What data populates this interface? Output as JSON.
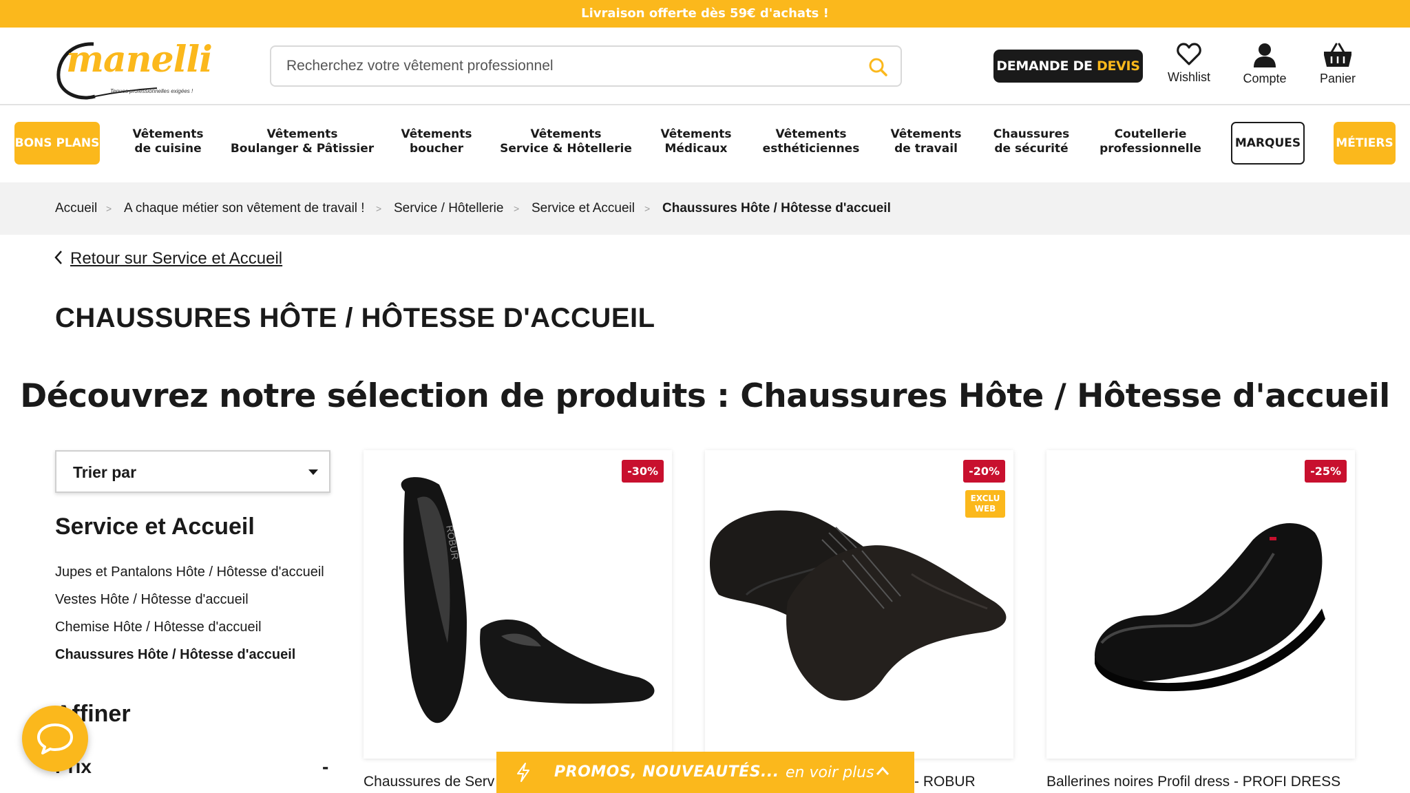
{
  "topbar": {
    "text": "Livraison offerte dès 59€ d'achats !"
  },
  "logo": {
    "word_first": "m",
    "word_rest": "anelli",
    "tagline": "Tenues professionnelles exigées !"
  },
  "search": {
    "placeholder": "Recherchez votre vêtement professionnel"
  },
  "devis": {
    "label_main": "DEMANDE DE ",
    "label_highlight": "DEVIS"
  },
  "header_icons": {
    "wishlist": "Wishlist",
    "account": "Compte",
    "cart": "Panier"
  },
  "nav": {
    "bons_plans": "BONS PLANS",
    "items": [
      {
        "l1": "Vêtements",
        "l2": "de cuisine"
      },
      {
        "l1": "Vêtements",
        "l2": "Boulanger & Pâtissier"
      },
      {
        "l1": "Vêtements",
        "l2": "boucher"
      },
      {
        "l1": "Vêtements",
        "l2": "Service & Hôtellerie"
      },
      {
        "l1": "Vêtements",
        "l2": "Médicaux"
      },
      {
        "l1": "Vêtements",
        "l2": "esthéticiennes"
      },
      {
        "l1": "Vêtements",
        "l2": "de travail"
      },
      {
        "l1": "Chaussures",
        "l2": "de sécurité"
      },
      {
        "l1": "Coutellerie",
        "l2": "professionnelle"
      }
    ],
    "marques": "MARQUES",
    "metiers": "MÉTIERS"
  },
  "breadcrumb": {
    "items": [
      "Accueil",
      "A chaque métier son vêtement de travail !",
      "Service / Hôtellerie",
      "Service et Accueil"
    ],
    "current": "Chaussures Hôte / Hôtesse d'accueil",
    "separator": ">"
  },
  "back_link": "Retour sur Service et Accueil",
  "page_title": "CHAUSSURES HÔTE / HÔTESSE D'ACCUEIL",
  "selection_heading": "Découvrez notre sélection de produits : Chaussures Hôte / Hôtesse d'accueil",
  "sidebar": {
    "sort_label": "Trier par",
    "category_title": "Service et Accueil",
    "categories": [
      {
        "label": "Jupes et Pantalons Hôte / Hôtesse d'accueil",
        "active": false
      },
      {
        "label": "Vestes Hôte / Hôtesse d'accueil",
        "active": false
      },
      {
        "label": "Chemise Hôte / Hôtesse d'accueil",
        "active": false
      },
      {
        "label": "Chaussures Hôte / Hôtesse d'accueil",
        "active": true
      }
    ],
    "refine_title": "Affiner",
    "price_label": "Prix",
    "price_toggle": "-"
  },
  "products": [
    {
      "title": "Chaussures de Serv",
      "discount": "-30%",
      "extra_badge": ""
    },
    {
      "title": "- ROBUR",
      "discount": "-20%",
      "extra_badge_l1": "EXCLU",
      "extra_badge_l2": "WEB"
    },
    {
      "title": "Ballerines noires Profil dress - PROFI DRESS",
      "discount": "-25%",
      "extra_badge": ""
    }
  ],
  "promo_bar": {
    "text": "PROMOS, NOUVEAUTÉS...",
    "more": "en voir plus"
  },
  "icons": [
    "search-icon",
    "heart-icon",
    "user-icon",
    "basket-icon",
    "chevron-left-icon",
    "caret-down-icon",
    "chat-icon",
    "bolt-icon",
    "chevron-up-icon"
  ],
  "colors": {
    "brand_yellow": "#fbb81c",
    "dark": "#1a1a1a",
    "discount_red": "#c8102e",
    "crumb_bg": "#f2f2f2"
  }
}
